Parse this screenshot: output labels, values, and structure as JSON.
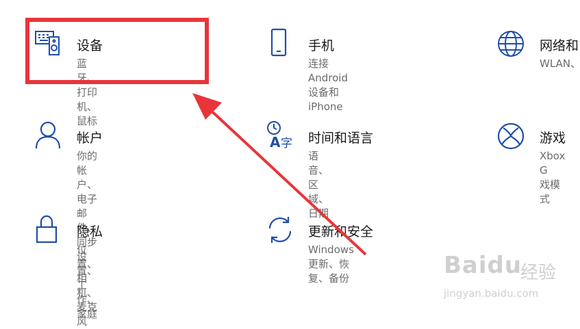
{
  "settings_tiles": [
    {
      "title": "设备",
      "desc": "蓝牙、打印机、鼠标",
      "icon": "devices-icon"
    },
    {
      "title": "手机",
      "desc": "连接 Android 设备和\niPhone",
      "icon": "phone-icon"
    },
    {
      "title": "网络和",
      "desc": "WLAN、",
      "icon": "globe-icon"
    },
    {
      "title": "帐户",
      "desc": "你的帐户、电子邮件、同步\n设置、工作、家庭",
      "icon": "person-icon"
    },
    {
      "title": "时间和语言",
      "desc": "语音、区域、日期",
      "icon": "time-language-icon"
    },
    {
      "title": "游戏",
      "desc": "Xbox G\n戏模式",
      "icon": "xbox-icon"
    },
    {
      "title": "隐私",
      "desc": "位置、相机、麦克风",
      "icon": "lock-icon"
    },
    {
      "title": "更新和安全",
      "desc": "Windows 更新、恢复、备份",
      "icon": "sync-icon"
    }
  ],
  "watermark": {
    "logo": "Baidu",
    "text": "经验",
    "url": "jingyan.baidu.com"
  },
  "colors": {
    "icon_blue": "#1f4ea8",
    "highlight_red": "#e8353a"
  }
}
